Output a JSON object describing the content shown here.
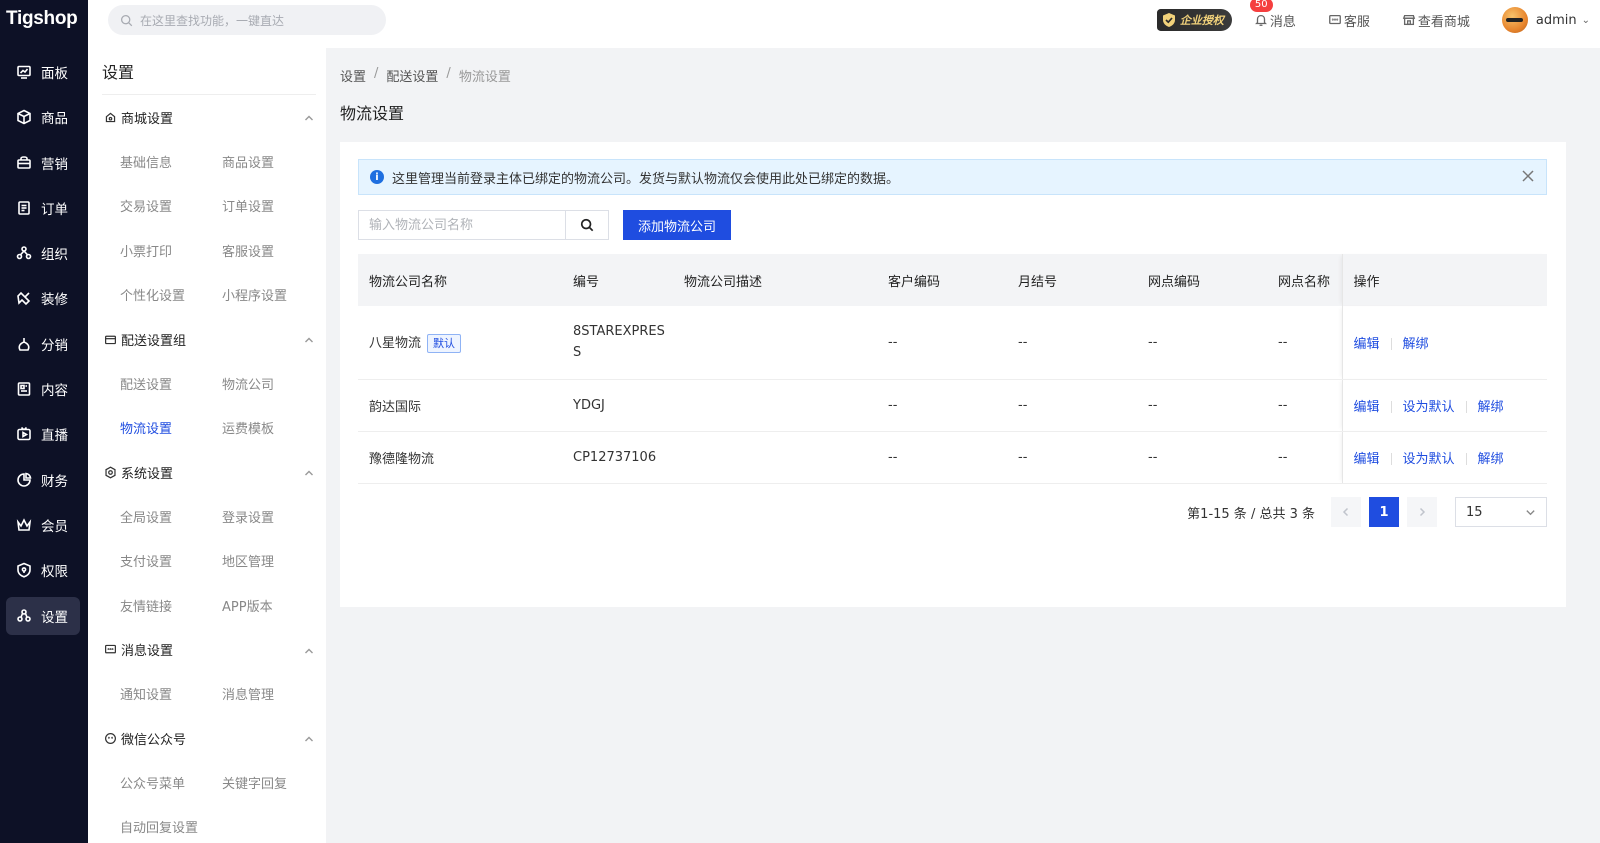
{
  "brand": {
    "logo_text": "Tigshop"
  },
  "nav": {
    "items": [
      {
        "label": "面板",
        "icon": "dashboard-icon"
      },
      {
        "label": "商品",
        "icon": "box-icon"
      },
      {
        "label": "营销",
        "icon": "marketing-icon"
      },
      {
        "label": "订单",
        "icon": "order-icon"
      },
      {
        "label": "组织",
        "icon": "org-icon"
      },
      {
        "label": "装修",
        "icon": "brush-icon"
      },
      {
        "label": "分销",
        "icon": "distribution-icon"
      },
      {
        "label": "内容",
        "icon": "content-icon"
      },
      {
        "label": "直播",
        "icon": "live-icon"
      },
      {
        "label": "财务",
        "icon": "finance-icon"
      },
      {
        "label": "会员",
        "icon": "member-icon"
      },
      {
        "label": "权限",
        "icon": "permission-icon"
      },
      {
        "label": "设置",
        "icon": "settings-icon",
        "active": true
      }
    ]
  },
  "header": {
    "search_placeholder": "在这里查找功能，一键直达",
    "enterprise_badge": "企业授权",
    "message_count": "50",
    "message_label": "消息",
    "service_label": "客服",
    "shop_label": "查看商城",
    "user_name": "admin"
  },
  "sidebar": {
    "title": "设置",
    "groups": [
      {
        "label": "商城设置",
        "items": [
          "基础信息",
          "商品设置",
          "交易设置",
          "订单设置",
          "小票打印",
          "客服设置",
          "个性化设置",
          "小程序设置"
        ]
      },
      {
        "label": "配送设置组",
        "items": [
          "配送设置",
          "物流公司",
          "物流设置",
          "运费模板"
        ]
      },
      {
        "label": "系统设置",
        "items": [
          "全局设置",
          "登录设置",
          "支付设置",
          "地区管理",
          "友情链接",
          "APP版本"
        ]
      },
      {
        "label": "消息设置",
        "items": [
          "通知设置",
          "消息管理"
        ]
      },
      {
        "label": "微信公众号",
        "items": [
          "公众号菜单",
          "关键字回复",
          "自动回复设置"
        ]
      }
    ]
  },
  "breadcrumb": [
    "设置",
    "配送设置",
    "物流设置"
  ],
  "page_title": "物流设置",
  "alert_text": "这里管理当前登录主体已绑定的物流公司。发货与默认物流仅会使用此处已绑定的数据。",
  "search": {
    "placeholder": "输入物流公司名称"
  },
  "add_button": "添加物流公司",
  "table": {
    "columns": [
      "物流公司名称",
      "编号",
      "物流公司描述",
      "客户编码",
      "月结号",
      "网点编码",
      "网点名称",
      "操作"
    ],
    "rows": [
      {
        "name": "八星物流",
        "tag": "默认",
        "code": "8STAREXPRESS",
        "desc": "",
        "customer_code": "--",
        "monthly_no": "--",
        "outlet_code": "--",
        "outlet_name": "--",
        "ops": [
          "编辑",
          "解绑"
        ]
      },
      {
        "name": "韵达国际",
        "code": "YDGJ",
        "desc": "",
        "customer_code": "--",
        "monthly_no": "--",
        "outlet_code": "--",
        "outlet_name": "--",
        "ops": [
          "编辑",
          "设为默认",
          "解绑"
        ]
      },
      {
        "name": "豫德隆物流",
        "code": "CP12737106",
        "desc": "",
        "customer_code": "--",
        "monthly_no": "--",
        "outlet_code": "--",
        "outlet_name": "--",
        "ops": [
          "编辑",
          "设为默认",
          "解绑"
        ]
      }
    ]
  },
  "pagination": {
    "summary": "第1-15 条 / 总共 3 条",
    "current_page": "1",
    "page_size": "15"
  },
  "colors": {
    "primary": "#1f4de0",
    "nav_bg": "#0d1126",
    "alert_bg": "#e6f4ff"
  }
}
